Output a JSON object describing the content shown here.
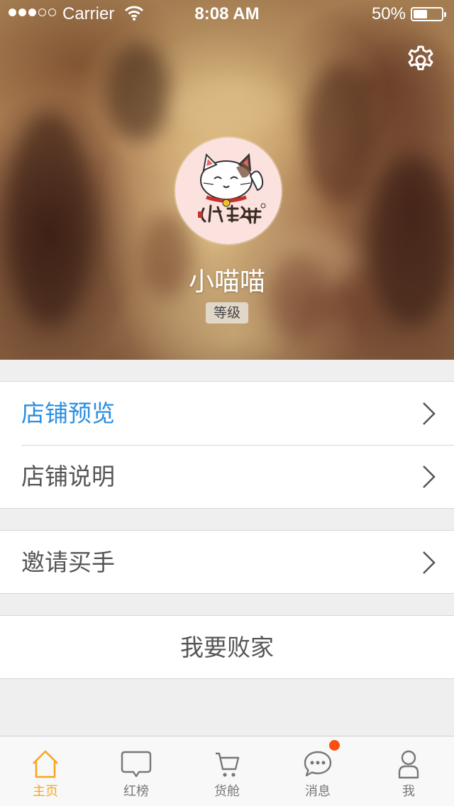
{
  "status_bar": {
    "carrier": "Carrier",
    "time": "8:08 AM",
    "battery_percent": "50%",
    "battery_level": 0.5,
    "signal_bars": 3
  },
  "header": {
    "shop_name": "小喵喵",
    "level_label": "等级",
    "settings_icon": "gear-icon",
    "avatar_icon": "lucky-cat-logo"
  },
  "menu": {
    "group1": [
      {
        "label": "店铺预览",
        "icon": "chevron-right-icon",
        "highlighted": true
      },
      {
        "label": "店铺说明",
        "icon": "chevron-right-icon",
        "highlighted": false
      }
    ],
    "group2": [
      {
        "label": "邀请买手",
        "icon": "chevron-right-icon"
      }
    ],
    "action_label": "我要败家"
  },
  "tab_bar": {
    "items": [
      {
        "label": "主页",
        "icon": "home-icon",
        "active": true
      },
      {
        "label": "红榜",
        "icon": "chat-bubble-icon",
        "active": false
      },
      {
        "label": "货舱",
        "icon": "cart-icon",
        "active": false
      },
      {
        "label": "消息",
        "icon": "message-icon",
        "active": false,
        "badge": true
      },
      {
        "label": "我",
        "icon": "user-icon",
        "active": false
      }
    ]
  },
  "colors": {
    "accent": "#2b8fe0",
    "tab_active": "#f5a623",
    "badge": "#fb4f12",
    "background": "#efefef"
  }
}
